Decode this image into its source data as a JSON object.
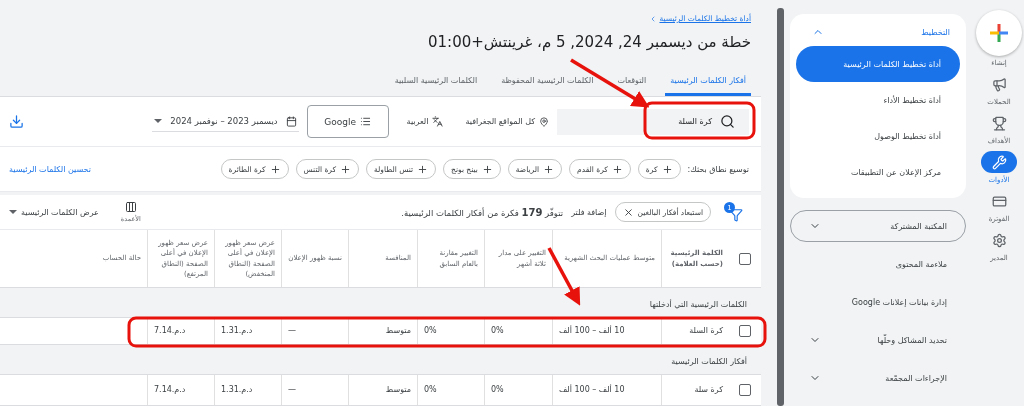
{
  "rail": [
    {
      "label": "إنشاء",
      "kind": "create",
      "selected": false
    },
    {
      "label": "الحملات",
      "kind": "campaigns",
      "selected": false
    },
    {
      "label": "الأهداف",
      "kind": "goals",
      "selected": false
    },
    {
      "label": "الأدوات",
      "kind": "tools",
      "selected": true
    },
    {
      "label": "الفوترة",
      "kind": "billing",
      "selected": false
    },
    {
      "label": "المدير",
      "kind": "admin",
      "selected": false
    }
  ],
  "nav": {
    "planning": {
      "title": "التخطيط",
      "expanded": true,
      "items": [
        {
          "label": "أداة تخطيط الكلمات الرئيسية",
          "selected": true
        },
        {
          "label": "أداة تخطيط الأداء",
          "selected": false
        },
        {
          "label": "أداة تخطيط الوصول",
          "selected": false
        },
        {
          "label": "مركز الإعلان عن التطبيقات",
          "selected": false
        }
      ]
    },
    "entries": [
      {
        "label": "المكتبة المشتركة",
        "kind": "group",
        "expanded": false,
        "outlined": true
      },
      {
        "label": "ملاءمة المحتوى",
        "kind": "link",
        "outlined": false
      },
      {
        "label": "إدارة بيانات إعلانات Google",
        "kind": "link",
        "outlined": false
      },
      {
        "label": "تحديد المشاكل وحلّها",
        "kind": "group",
        "expanded": false,
        "outlined": false
      },
      {
        "label": "الإجراءات المجمّعة",
        "kind": "group",
        "expanded": false,
        "outlined": false
      }
    ]
  },
  "main": {
    "breadcrumb": "أداة تخطيط الكلمات الرئيسية",
    "title": "خطة من ديسمبر 24, 2024, 5 م، غرينتش+01:00",
    "tabs": [
      {
        "label": "أفكار الكلمات الرئيسية",
        "selected": true
      },
      {
        "label": "التوقعات",
        "selected": false
      },
      {
        "label": "الكلمات الرئيسية المحفوظة",
        "selected": false
      },
      {
        "label": "الكلمات الرئيسية السلبية",
        "selected": false
      }
    ],
    "search": {
      "value": "كرة السلة"
    },
    "location": "كل المواقع الجغرافية",
    "language": "العربية",
    "network": "Google",
    "date_range": "ديسمبر 2023 – نوفمبر 2024",
    "broaden": {
      "label": "توسيع نطاق بحثك:",
      "chips": [
        "كرة",
        "كرة القدم",
        "الرياضة",
        "بينج بونج",
        "تنس الطاولة",
        "كرة التنس",
        "كرة الطائرة"
      ]
    },
    "refine_link": "تحسين الكلمات الرئيسية",
    "filters": {
      "badge": "1",
      "chips": [
        "استبعاد أفكار البالغين"
      ],
      "add_filter": "إضافة فلتر",
      "summary": "تتوفّر **179** فكرة من أفكار الكلمات الرئيسية."
    },
    "columns_button": "الأعمدة",
    "view_menu": "عرض الكلمات الرئيسية",
    "table": {
      "select_all_checked": false,
      "columns": [
        {
          "label": "الكلمة الرئيسية (حسب العلامة)",
          "kind": "keyword"
        },
        {
          "label": "متوسط عمليات البحث الشهرية",
          "kind": "number"
        },
        {
          "label": "التغيير على مدار ثلاثة أشهر",
          "kind": "number"
        },
        {
          "label": "التغيير مقارنة بالعام السابق",
          "kind": "number"
        },
        {
          "label": "المنافسة",
          "kind": "text"
        },
        {
          "label": "نسبة ظهور الإعلان",
          "kind": "number"
        },
        {
          "label": "عرض سعر ظهور الإعلان في أعلى الصفحة (النطاق المنخفض)",
          "kind": "number"
        },
        {
          "label": "عرض سعر ظهور الإعلان في أعلى الصفحة (النطاق المرتفع)",
          "kind": "number"
        },
        {
          "label": "حالة الحساب",
          "kind": "text"
        }
      ],
      "groups": [
        {
          "label": "الكلمات الرئيسية التي أدخلتها",
          "rows": [
            {
              "checked": false,
              "cells": [
                "كرة السلة",
                "10 ألف – 100 ألف",
                "0%",
                "0%",
                "متوسط",
                "—",
                "د.م.1.31",
                "د.م.7.14"
              ]
            }
          ]
        },
        {
          "label": "أفكار الكلمات الرئيسية",
          "rows": [
            {
              "checked": false,
              "cells": [
                "كرة سلة",
                "10 ألف – 100 ألف",
                "0%",
                "0%",
                "متوسط",
                "—",
                "د.م.1.31",
                "د.م.7.14"
              ]
            }
          ]
        }
      ]
    }
  }
}
